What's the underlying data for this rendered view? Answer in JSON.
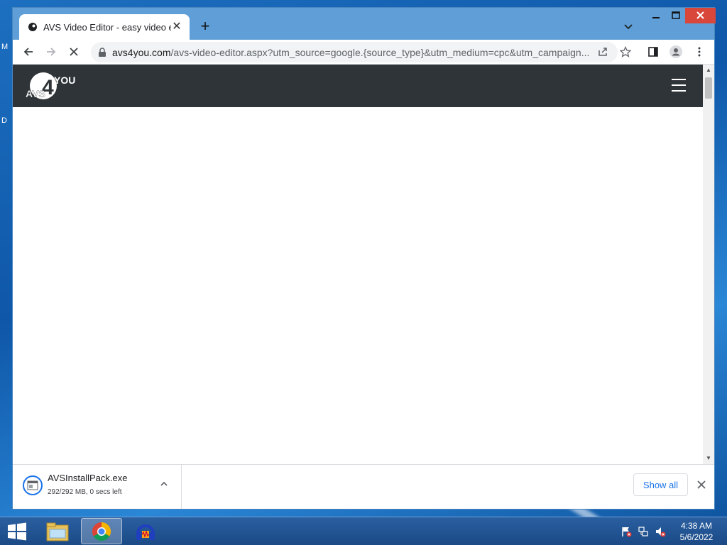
{
  "desktop": {
    "left_letters": [
      "M",
      "D"
    ]
  },
  "browser": {
    "tab": {
      "title": "AVS Video Editor - easy video ed",
      "favicon": "avs-favicon-icon"
    },
    "new_tab_symbol": "+",
    "address": {
      "host": "avs4you.com",
      "path": "/avs-video-editor.aspx?utm_source=google.{source_type}&utm_medium=cpc&utm_campaign..."
    }
  },
  "site": {
    "logo_text_avs": "AVS",
    "logo_text_4": "4",
    "logo_text_you": "YOU"
  },
  "download": {
    "filename": "AVSInstallPack.exe",
    "status": "292/292 MB, 0 secs left",
    "show_all_label": "Show all"
  },
  "taskbar": {
    "apps": [
      "file-explorer-icon",
      "chrome-icon",
      "audio-headphones-icon"
    ],
    "time": "4:38 AM",
    "date": "5/6/2022"
  }
}
